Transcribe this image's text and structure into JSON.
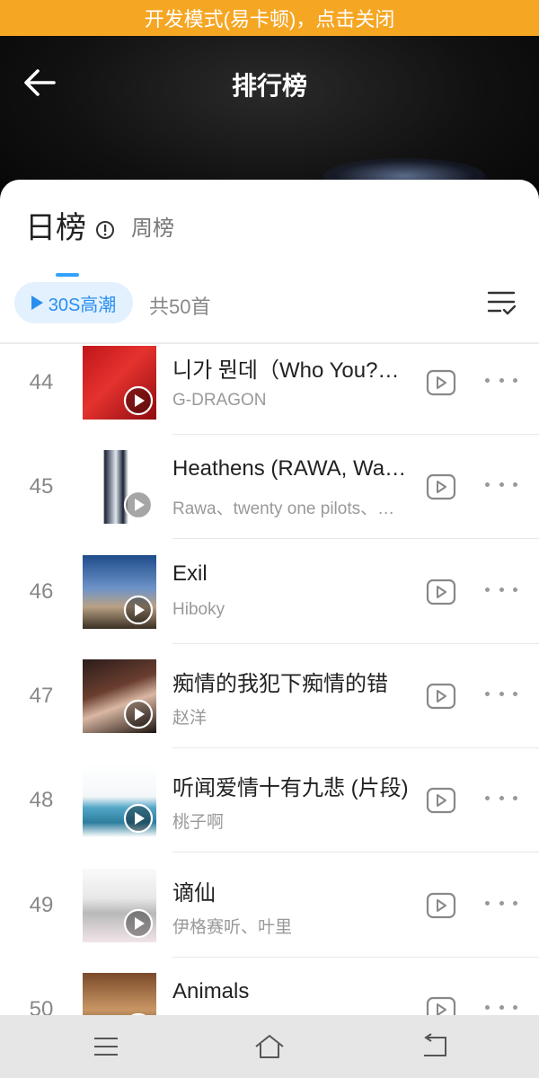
{
  "dev_banner": "开发模式(易卡顿)，点击关闭",
  "header": {
    "title": "排行榜",
    "back_icon": "arrow-left-icon"
  },
  "tabs": {
    "daily": "日榜",
    "weekly": "周榜"
  },
  "toolbar": {
    "play_chip": "30S高潮",
    "count": "共50首"
  },
  "songs": [
    {
      "rank": "44",
      "title": "니가 뭔데（Who You?…",
      "artist": "G-DRAGON"
    },
    {
      "rank": "45",
      "title": "Heathens (RAWA, Wa…",
      "artist": "Rawa、twenty one pilots、…"
    },
    {
      "rank": "46",
      "title": "Exil",
      "artist": "Hiboky"
    },
    {
      "rank": "47",
      "title": "痴情的我犯下痴情的错",
      "artist": "赵洋"
    },
    {
      "rank": "48",
      "title": "听闻爱情十有九悲 (片段)",
      "artist": "桃子啊"
    },
    {
      "rank": "49",
      "title": "谪仙",
      "artist": "伊格赛听、叶里"
    },
    {
      "rank": "50",
      "title": "Animals",
      "artist": ""
    }
  ],
  "colors": {
    "banner": "#f5a623",
    "accent": "#2a8ef0",
    "chip_bg": "#e3f1ff"
  },
  "nav": {
    "menu_icon": "menu-icon",
    "home_icon": "home-icon",
    "back_icon": "system-back-icon"
  }
}
